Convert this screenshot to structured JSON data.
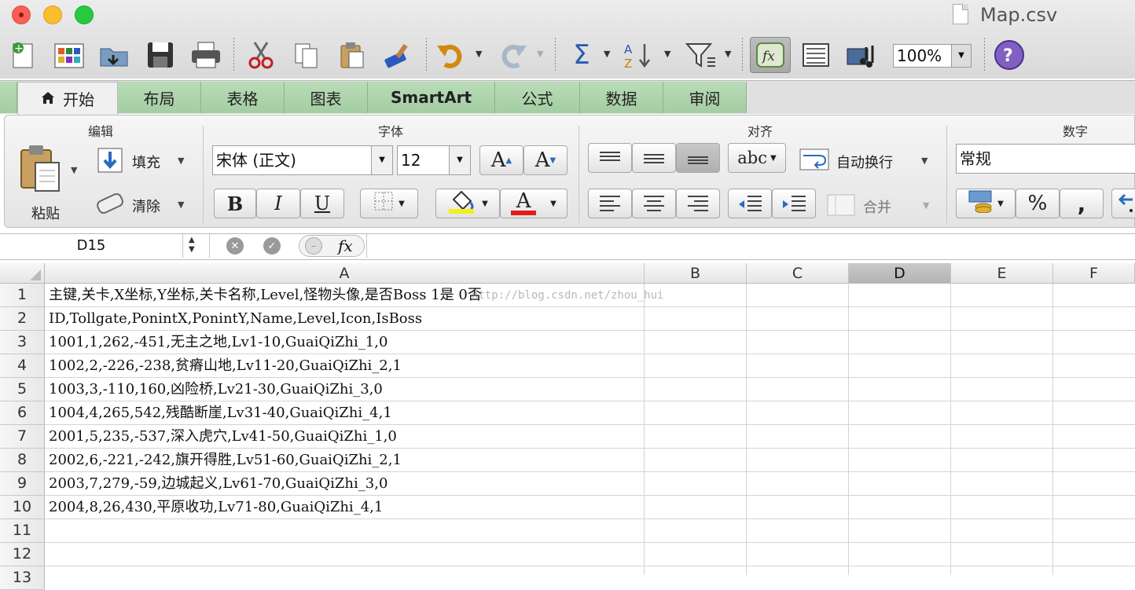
{
  "window": {
    "title": "Map.csv"
  },
  "toolbar": {
    "zoom": "100%",
    "icons": [
      "new-icon",
      "templates-icon",
      "open-icon",
      "save-icon",
      "print-icon",
      "cut-icon",
      "copy-icon",
      "paste-icon",
      "format-painter-icon",
      "undo-icon",
      "redo-icon",
      "autosum-icon",
      "sort-icon",
      "filter-icon",
      "formula-builder-icon",
      "show-hide-icon",
      "media-browser-icon",
      "help-icon"
    ]
  },
  "tabs": [
    "开始",
    "布局",
    "表格",
    "图表",
    "SmartArt",
    "公式",
    "数据",
    "审阅"
  ],
  "ribbon": {
    "edit": {
      "title": "编辑",
      "paste": "粘贴",
      "fill": "填充",
      "clear": "清除"
    },
    "font": {
      "title": "字体",
      "family": "宋体 (正文)",
      "size": "12",
      "bold": "B",
      "italic": "I",
      "underline": "U",
      "grow": "A",
      "shrink": "A",
      "font_color": "A"
    },
    "align": {
      "title": "对齐",
      "wrap": "自动换行",
      "merge": "合并",
      "orientation": "abc"
    },
    "number": {
      "title": "数字",
      "format": "常规",
      "percent": "%",
      "comma": ","
    }
  },
  "formula_bar": {
    "name_box": "D15",
    "fx": "fx",
    "value": ""
  },
  "sheet": {
    "columns": [
      "A",
      "B",
      "C",
      "D",
      "E",
      "F"
    ],
    "selected_column": "D",
    "rows": [
      {
        "n": "1",
        "a": "主键,关卡,X坐标,Y坐标,关卡名称,Level,怪物头像,是否Boss 1是 0否"
      },
      {
        "n": "2",
        "a": "ID,Tollgate,PonintX,PonintY,Name,Level,Icon,IsBoss"
      },
      {
        "n": "3",
        "a": "1001,1,262,-451,无主之地,Lv1-10,GuaiQiZhi_1,0"
      },
      {
        "n": "4",
        "a": "1002,2,-226,-238,贫瘠山地,Lv11-20,GuaiQiZhi_2,1"
      },
      {
        "n": "5",
        "a": "1003,3,-110,160,凶险桥,Lv21-30,GuaiQiZhi_3,0"
      },
      {
        "n": "6",
        "a": "1004,4,265,542,残酷断崖,Lv31-40,GuaiQiZhi_4,1"
      },
      {
        "n": "7",
        "a": "2001,5,235,-537,深入虎穴,Lv41-50,GuaiQiZhi_1,0"
      },
      {
        "n": "8",
        "a": "2002,6,-221,-242,旗开得胜,Lv51-60,GuaiQiZhi_2,1"
      },
      {
        "n": "9",
        "a": "2003,7,279,-59,边城起义,Lv61-70,GuaiQiZhi_3,0"
      },
      {
        "n": "10",
        "a": "2004,8,26,430,平原收功,Lv71-80,GuaiQiZhi_4,1"
      },
      {
        "n": "11",
        "a": ""
      },
      {
        "n": "12",
        "a": ""
      },
      {
        "n": "13",
        "a": ""
      }
    ],
    "watermark": "http://blog.csdn.net/zhou_hui"
  }
}
